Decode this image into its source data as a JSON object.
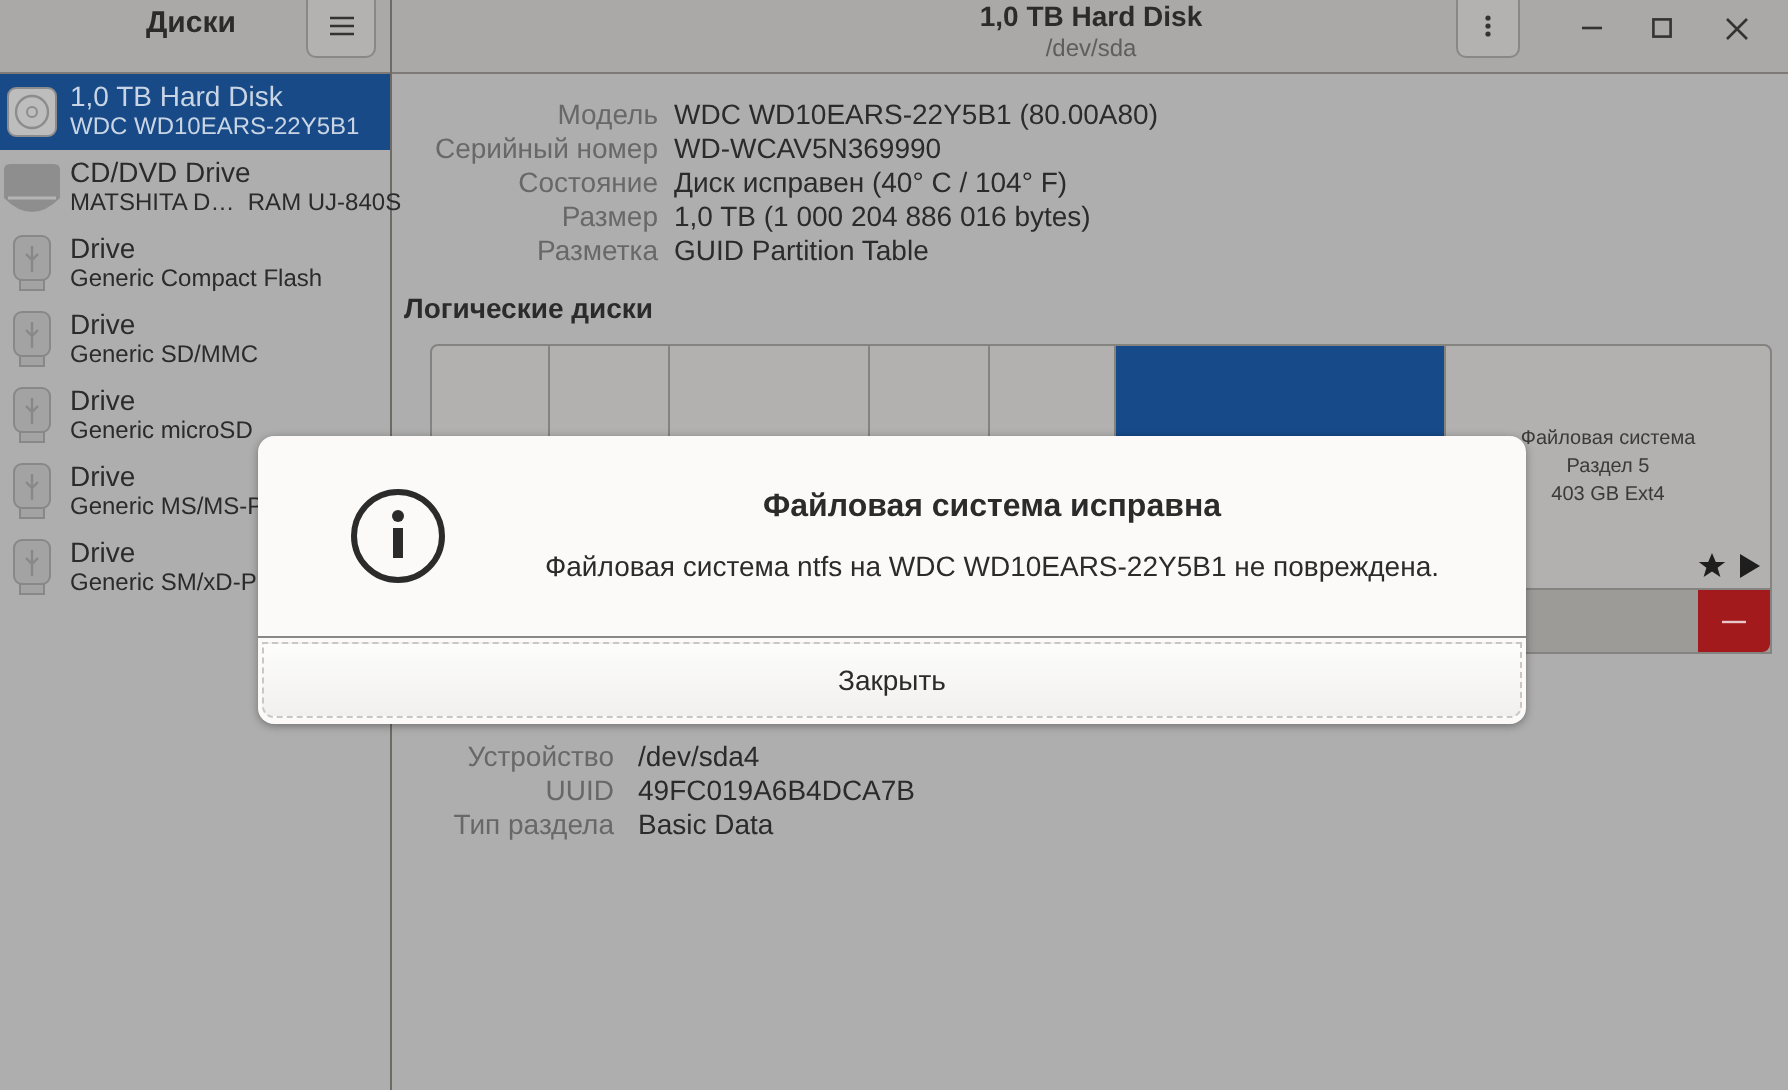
{
  "sidebar": {
    "title": "Диски",
    "items": [
      {
        "kind": "hdd",
        "name": "1,0 TB Hard Disk",
        "model": "WDC WD10EARS-22Y5B1",
        "selected": true
      },
      {
        "kind": "optical",
        "name": "CD/DVD Drive",
        "model": "MATSHITA D…  RAM UJ-840S",
        "selected": false
      },
      {
        "kind": "usb",
        "name": "Drive",
        "model": "Generic Compact Flash",
        "selected": false
      },
      {
        "kind": "usb",
        "name": "Drive",
        "model": "Generic SD/MMC",
        "selected": false
      },
      {
        "kind": "usb",
        "name": "Drive",
        "model": "Generic microSD",
        "selected": false
      },
      {
        "kind": "usb",
        "name": "Drive",
        "model": "Generic MS/MS-P",
        "selected": false
      },
      {
        "kind": "usb",
        "name": "Drive",
        "model": "Generic SM/xD-P",
        "selected": false
      }
    ]
  },
  "header": {
    "title": "1,0 TB Hard Disk",
    "subtitle": "/dev/sda"
  },
  "drive_info": [
    {
      "label": "Модель",
      "value": "WDC WD10EARS-22Y5B1 (80.00A80)"
    },
    {
      "label": "Серийный номер",
      "value": "WD-WCAV5N369990"
    },
    {
      "label": "Состояние",
      "value": "Диск исправен (40° C / 104° F)"
    },
    {
      "label": "Размер",
      "value": "1,0 TB (1 000 204 886 016 bytes)"
    },
    {
      "label": "Разметка",
      "value": "GUID Partition Table"
    }
  ],
  "volumes_heading": "Логические диски",
  "volumes": [
    {
      "selected": false
    },
    {
      "selected": false
    },
    {
      "selected": false
    },
    {
      "selected": false
    },
    {
      "selected": false
    },
    {
      "selected": true
    },
    {
      "selected": false,
      "lines": [
        "Файловая система",
        "Раздел 5",
        "403 GB Ext4"
      ]
    }
  ],
  "partition_info": [
    {
      "label": "Устройство",
      "value": "/dev/sda4"
    },
    {
      "label": "UUID",
      "value": "49FC019A6B4DCA7B"
    },
    {
      "label": "Тип раздела",
      "value": "Basic Data"
    }
  ],
  "dialog": {
    "title": "Файловая система исправна",
    "message": "Файловая система ntfs на WDC WD10EARS-22Y5B1 не повреждена.",
    "button": "Закрыть"
  }
}
